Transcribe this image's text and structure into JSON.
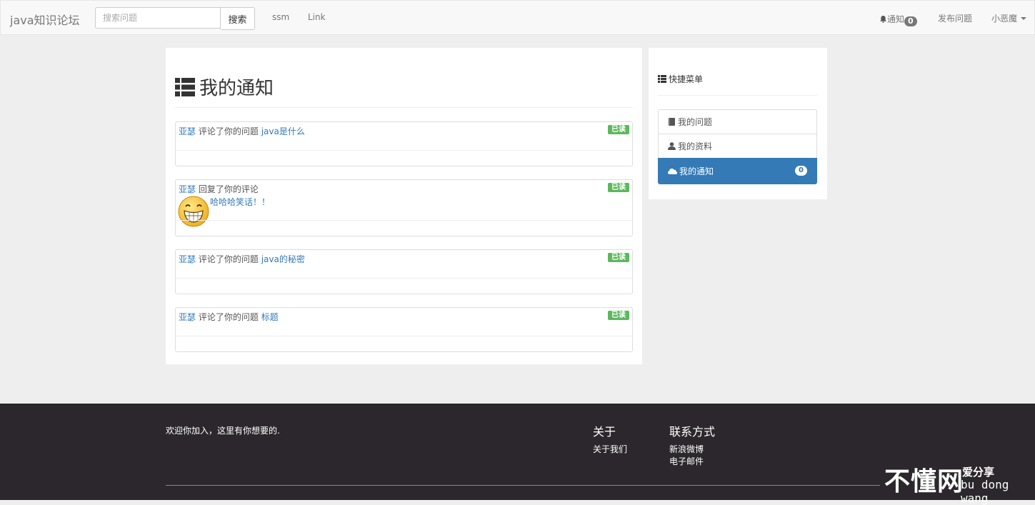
{
  "navbar": {
    "brand": "java知识论坛",
    "search_placeholder": "搜索问题",
    "search_button": "搜索",
    "links": [
      "ssm",
      "Link"
    ],
    "notify_label": "通知",
    "notify_count": "0",
    "publish_label": "发布问题",
    "user_name": "小恶魔"
  },
  "main": {
    "title": "我的通知",
    "notifications": [
      {
        "user": "亚瑟",
        "action": "评论了你的问题",
        "target": "java是什么",
        "badge": "已读"
      },
      {
        "user": "亚瑟",
        "action": "回复了你的评论",
        "reply": "哈哈哈笑话！！",
        "badge": "已读"
      },
      {
        "user": "亚瑟",
        "action": "评论了你的问题",
        "target": "java的秘密",
        "badge": "已读"
      },
      {
        "user": "亚瑟",
        "action": "评论了你的问题",
        "target": "标题",
        "badge": "已读"
      }
    ]
  },
  "sidebar": {
    "title": "快捷菜单",
    "items": [
      {
        "label": "我的问题",
        "icon": "book-icon"
      },
      {
        "label": "我的资料",
        "icon": "user-icon"
      },
      {
        "label": "我的通知",
        "icon": "cloud-icon",
        "count": "0"
      }
    ]
  },
  "footer": {
    "welcome": "欢迎你加入，这里有你想要的.",
    "about_title": "关于",
    "about_link": "关于我们",
    "contact_title": "联系方式",
    "contact_weibo": "新浪微博",
    "contact_email": "电子邮件"
  },
  "watermark": {
    "main": "不懂网",
    "sub": "爱分享",
    "pinyin": "bu dong wang"
  },
  "colors": {
    "primary": "#337ab7",
    "success": "#5cb85c",
    "footer_bg": "#2c272c",
    "page_bg": "#eeeeee"
  }
}
